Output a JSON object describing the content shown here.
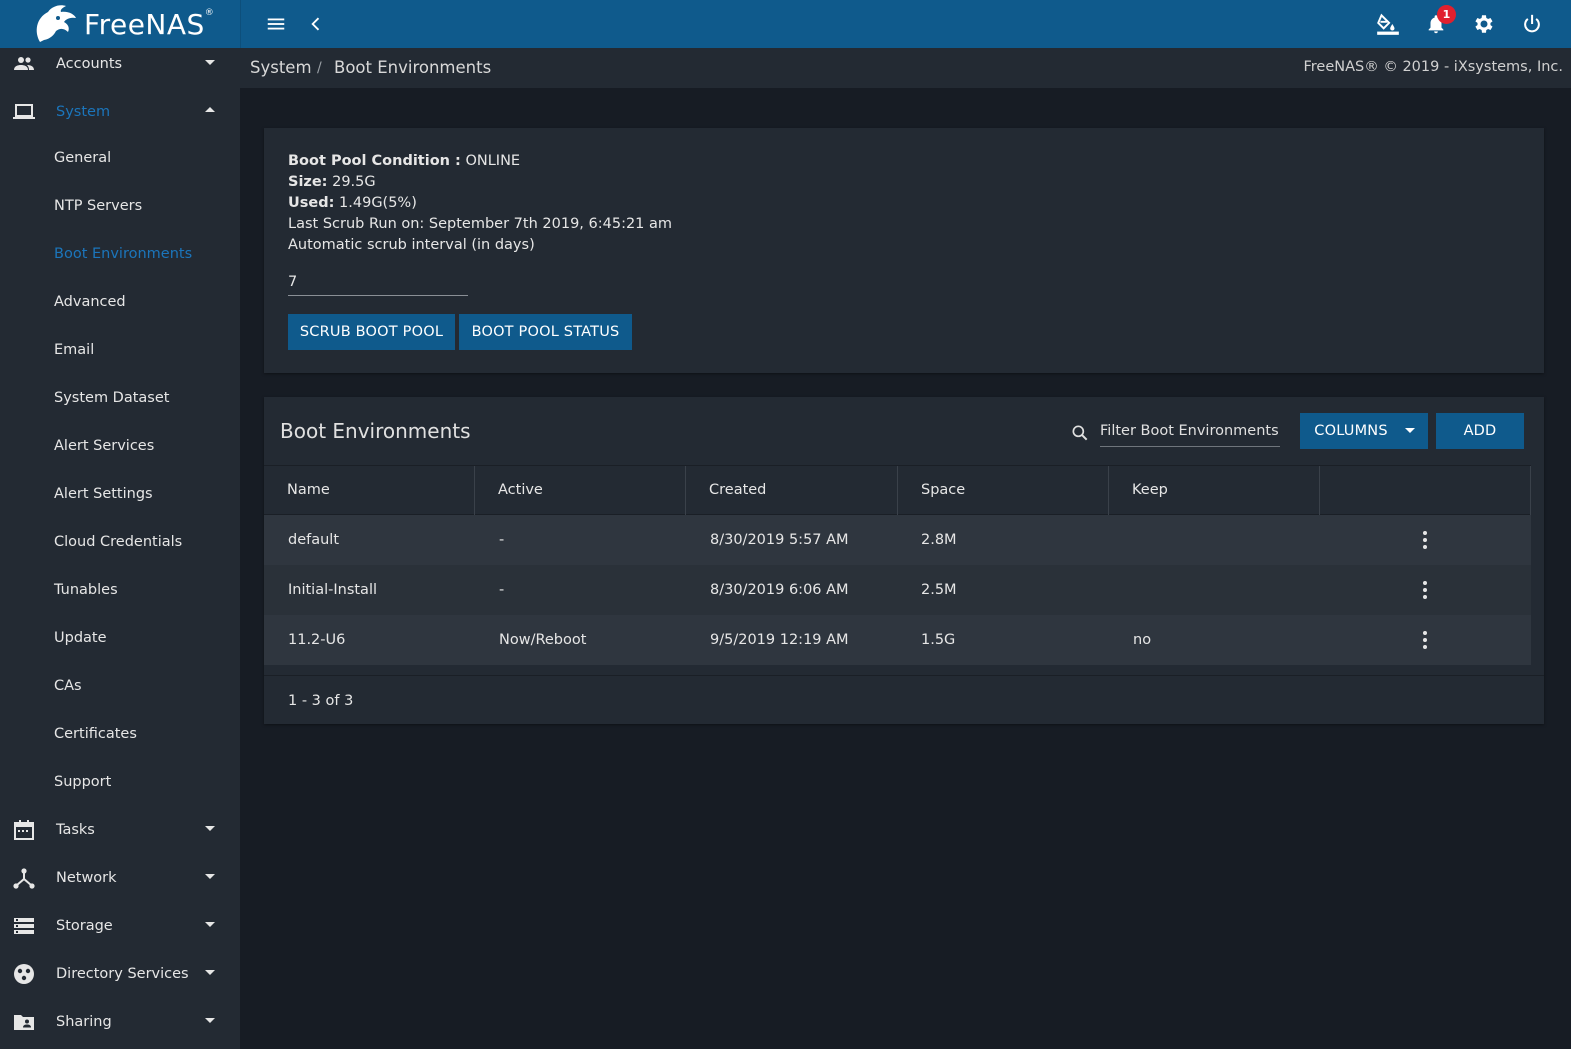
{
  "app": {
    "logo_text": "FreeNAS",
    "logo_mark": "®",
    "notification_count": "1",
    "colors": {
      "topbar": "#0f5a8c",
      "sidebar": "#232a33",
      "background": "#171c24",
      "accent": "#1b75bb",
      "badge": "#e0202e"
    }
  },
  "topbar": {
    "icons": [
      "menu-icon",
      "chevron-left-icon",
      "paint-bucket-icon",
      "bell-icon",
      "gear-icon",
      "power-icon"
    ]
  },
  "sidebar": {
    "items": [
      {
        "label": "Accounts",
        "icon": "people-icon",
        "expanded": false
      },
      {
        "label": "System",
        "icon": "laptop-icon",
        "expanded": true
      },
      {
        "label": "Tasks",
        "icon": "calendar-icon",
        "expanded": false
      },
      {
        "label": "Network",
        "icon": "network-icon",
        "expanded": false
      },
      {
        "label": "Storage",
        "icon": "storage-icon",
        "expanded": false
      },
      {
        "label": "Directory Services",
        "icon": "directory-icon",
        "expanded": false
      },
      {
        "label": "Sharing",
        "icon": "folder-shared-icon",
        "expanded": false
      }
    ],
    "system_sub": [
      "General",
      "NTP Servers",
      "Boot Environments",
      "Advanced",
      "Email",
      "System Dataset",
      "Alert Services",
      "Alert Settings",
      "Cloud Credentials",
      "Tunables",
      "Update",
      "CAs",
      "Certificates",
      "Support"
    ],
    "active_sub": "Boot Environments"
  },
  "breadcrumb": {
    "section": "System",
    "separator": "/",
    "page": "Boot Environments"
  },
  "copyright": "FreeNAS® © 2019 - iXsystems, Inc.",
  "boot_pool": {
    "condition_label": "Boot Pool Condition :",
    "condition_value": "ONLINE",
    "size_label": "Size:",
    "size_value": "29.5G",
    "used_label": "Used:",
    "used_value": "1.49G(5%)",
    "last_scrub": "Last Scrub Run on: September 7th 2019, 6:45:21 am",
    "scrub_interval_label": "Automatic scrub interval (in days)",
    "scrub_interval_value": "7",
    "scrub_button": "SCRUB BOOT POOL",
    "status_button": "BOOT POOL STATUS"
  },
  "table": {
    "title": "Boot Environments",
    "filter_placeholder": "Filter Boot Environments",
    "columns_button": "COLUMNS",
    "add_button": "ADD",
    "headers": [
      "Name",
      "Active",
      "Created",
      "Space",
      "Keep"
    ],
    "rows": [
      {
        "name": "default",
        "active": "-",
        "created": "8/30/2019 5:57 AM",
        "space": "2.8M",
        "keep": ""
      },
      {
        "name": "Initial-Install",
        "active": "-",
        "created": "8/30/2019 6:06 AM",
        "space": "2.5M",
        "keep": ""
      },
      {
        "name": "11.2-U6",
        "active": "Now/Reboot",
        "created": "9/5/2019 12:19 AM",
        "space": "1.5G",
        "keep": "no"
      }
    ],
    "pagination": "1 - 3 of 3"
  }
}
